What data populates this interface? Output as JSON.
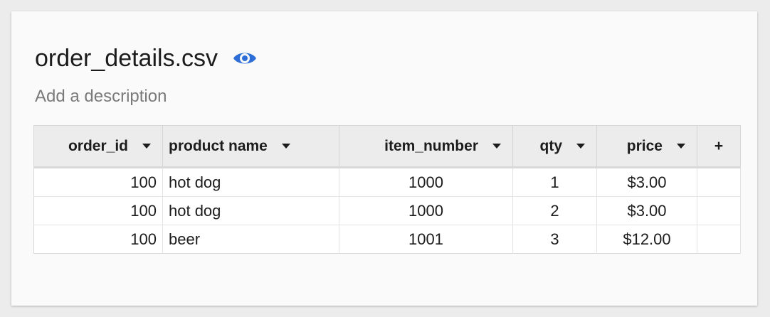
{
  "file": {
    "title": "order_details.csv",
    "description_placeholder": "Add a description",
    "visibility_icon": "eye-icon",
    "accent_color": "#2d6fd6"
  },
  "table": {
    "columns": [
      {
        "label": "order_id",
        "align": "right"
      },
      {
        "label": "product name",
        "align": "left"
      },
      {
        "label": "item_number",
        "align": "center"
      },
      {
        "label": "qty",
        "align": "center"
      },
      {
        "label": "price",
        "align": "center"
      }
    ],
    "add_column_label": "+",
    "rows": [
      [
        "100",
        "hot dog",
        "1000",
        "1",
        "$3.00"
      ],
      [
        "100",
        "hot dog",
        "1000",
        "2",
        "$3.00"
      ],
      [
        "100",
        "beer",
        "1001",
        "3",
        "$12.00"
      ]
    ]
  }
}
